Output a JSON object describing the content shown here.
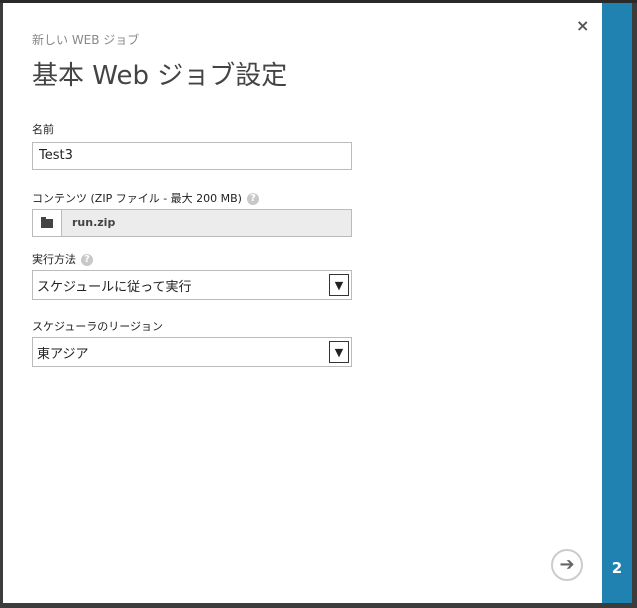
{
  "dialog": {
    "subtitle": "新しい WEB ジョブ",
    "title": "基本 Web ジョブ設定",
    "close_icon": "×",
    "name_label": "名前",
    "name_value": "Test3",
    "content_label": "コンテンツ (ZIP ファイル - 最大 200 MB)",
    "content_file": "run.zip",
    "method_label": "実行方法",
    "method_value": "スケジュールに従って実行",
    "region_label": "スケジューラのリージョン",
    "region_value": "東アジア",
    "help_glyph": "?",
    "next_glyph": "➔"
  },
  "steps": {
    "current": "2"
  },
  "colors": {
    "accent": "#1f82b0"
  }
}
